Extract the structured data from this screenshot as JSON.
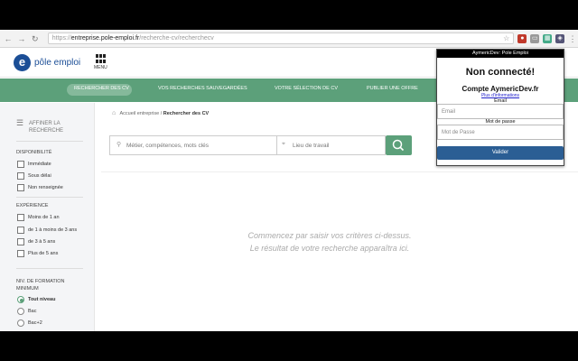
{
  "browser": {
    "url_proto": "https://",
    "url_host": "entreprise.pole-emploi.fr",
    "url_path": "/recherche-cv/recherchecv"
  },
  "header": {
    "logo_text": "pôle emploi",
    "menu_label": "MENU"
  },
  "nav": {
    "items": [
      "RECHERCHER DES CV",
      "VOS RECHERCHES SAUVEGARDÉES",
      "VOTRE SÉLECTION DE CV",
      "PUBLIER UNE OFFRE"
    ]
  },
  "sidebar": {
    "affiner": "AFFINER LA RECHERCHE",
    "disponibilite": {
      "title": "DISPONIBILITÉ",
      "options": [
        "Immédiate",
        "Sous délai",
        "Non renseignée"
      ]
    },
    "experience": {
      "title": "EXPÉRIENCE",
      "options": [
        "Moins de 1 an",
        "de 1 à moins de 3 ans",
        "de 3 à 5 ans",
        "Plus de 5 ans"
      ]
    },
    "formation": {
      "title": "NIV. DE FORMATION MINIMUM",
      "options": [
        "Tout niveau",
        "Bac",
        "Bac+2"
      ]
    }
  },
  "breadcrumb": {
    "home": "Accueil entreprise",
    "current": "Rechercher des CV"
  },
  "search": {
    "job_placeholder": "Métier, compétences, mots clés",
    "location_placeholder": "Lieu de travail"
  },
  "empty_state": {
    "line1": "Commencez par saisir vos critères ci-dessus.",
    "line2": "Le résultat de votre recherche apparaîtra ici."
  },
  "popup": {
    "bar_title": "AymericDev: Pole Emploi",
    "status": "Non connecté!",
    "account": "Compte AymericDev.fr",
    "more_info": "Plus d'informations",
    "email_label": "Email",
    "email_placeholder": "Email",
    "password_label": "Mot de passe",
    "password_placeholder": "Mot de Passe",
    "submit": "Valider"
  },
  "colors": {
    "brand_green": "#5ca07a",
    "brand_blue": "#1b4e96",
    "submit_blue": "#2b5e94"
  }
}
